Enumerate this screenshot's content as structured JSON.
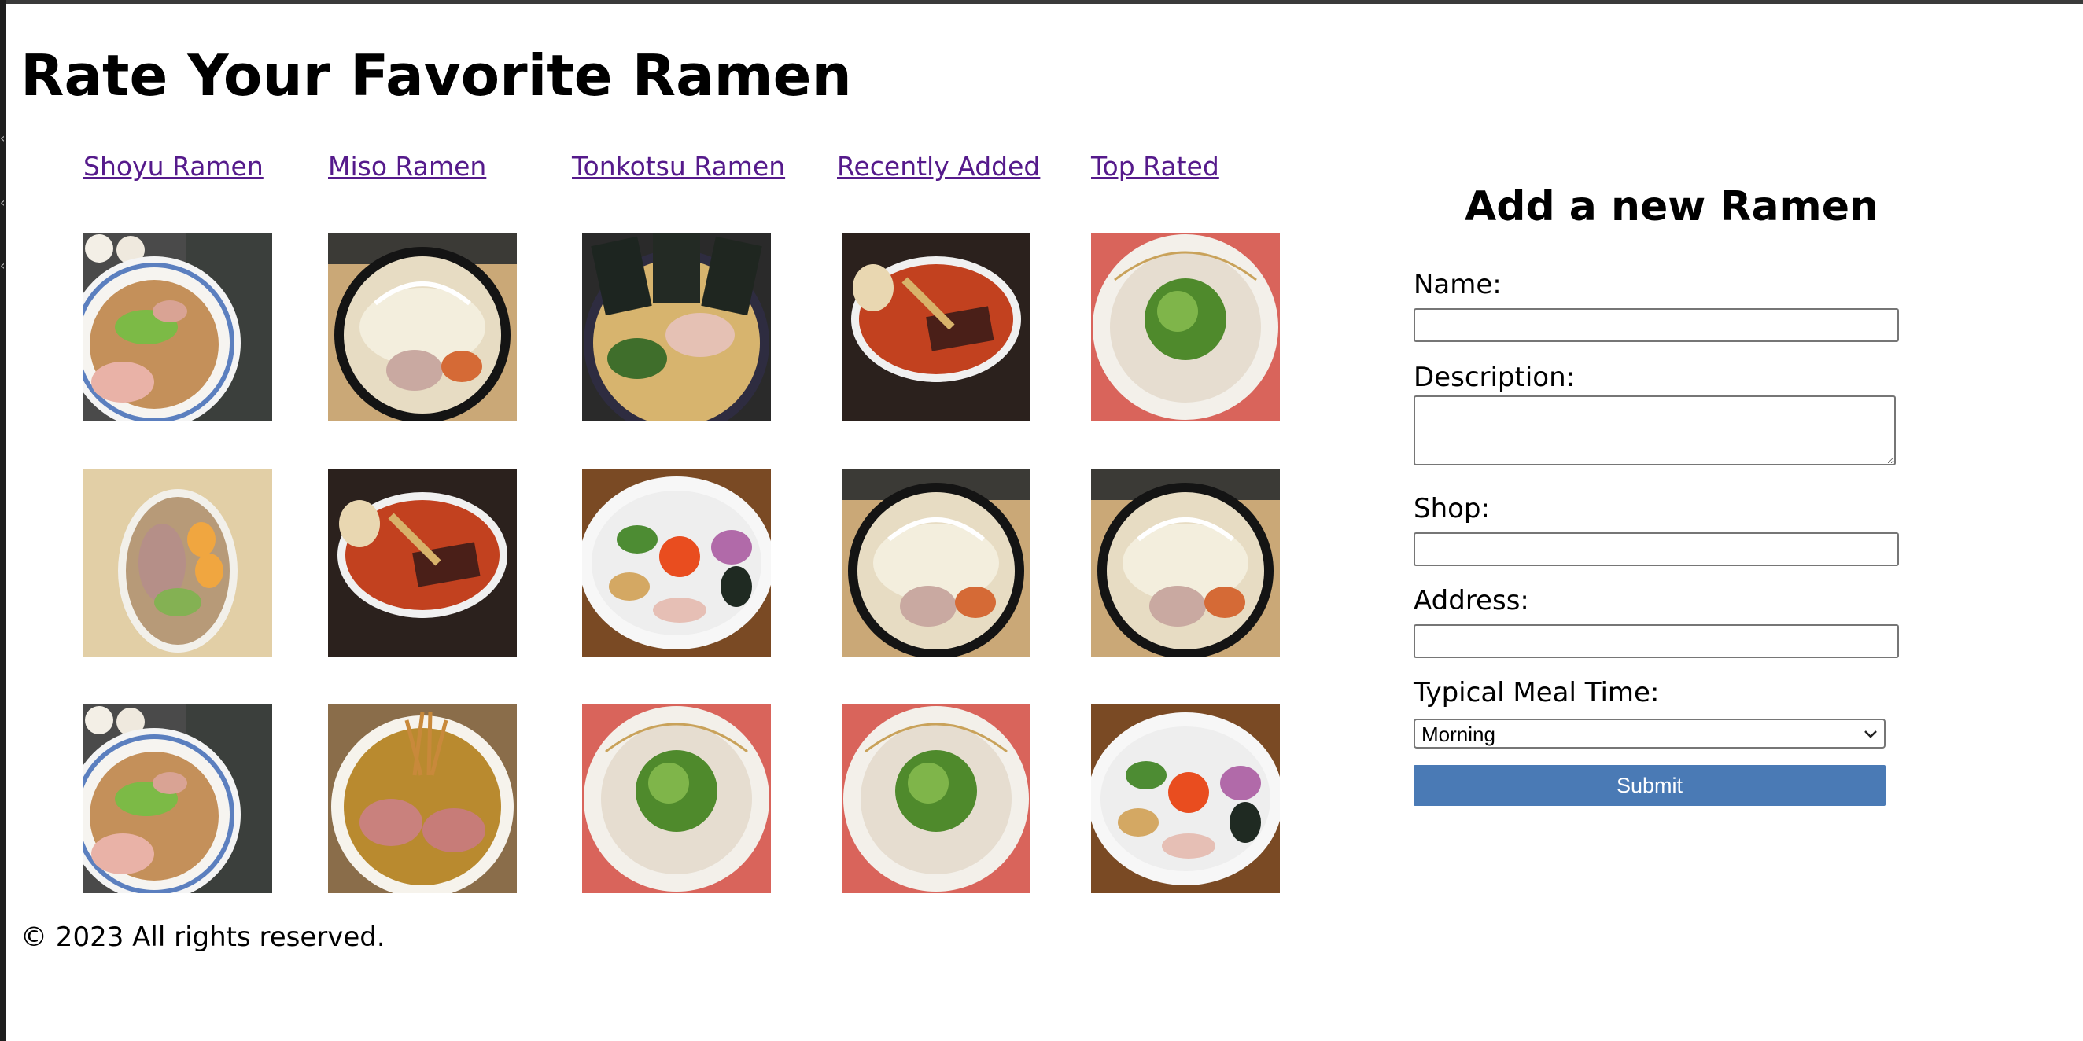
{
  "page": {
    "title": "Rate Your Favorite Ramen"
  },
  "nav": [
    {
      "label": "Shoyu Ramen"
    },
    {
      "label": "Miso Ramen"
    },
    {
      "label": "Tonkotsu Ramen"
    },
    {
      "label": "Recently Added"
    },
    {
      "label": "Top Rated"
    }
  ],
  "gallery": {
    "rows": [
      [
        "shoyu-bowl-with-chashu-and-scallions",
        "miso-bowl-with-bean-sprouts",
        "tonkotsu-bowl-with-nori-and-chashu",
        "spicy-red-bowl-with-egg",
        "tonkotsu-bowl-with-scallions"
      ],
      [
        "shoyu-bowl-with-eggs-top-view",
        "spicy-red-bowl-with-egg",
        "mazesoba-bowl-with-egg-yolk",
        "miso-bowl-with-bean-sprouts",
        "miso-bowl-with-bean-sprouts"
      ],
      [
        "shoyu-bowl-with-chashu-and-scallions",
        "miso-bowl-with-chashu-and-fried-onion",
        "tonkotsu-bowl-with-scallions",
        "tonkotsu-bowl-with-scallions",
        "mazesoba-bowl-with-egg-yolk"
      ]
    ]
  },
  "form": {
    "title": "Add a new Ramen",
    "name_label": "Name:",
    "name_value": "",
    "description_label": "Description:",
    "description_value": "",
    "shop_label": "Shop:",
    "shop_value": "",
    "address_label": "Address:",
    "address_value": "",
    "meal_time_label": "Typical Meal Time:",
    "meal_time_selected": "Morning",
    "submit_label": "Submit"
  },
  "footer": {
    "copyright": "© 2023 All rights reserved."
  },
  "colors": {
    "link": "#551a8b",
    "submit_bg": "#4a7ab5"
  }
}
